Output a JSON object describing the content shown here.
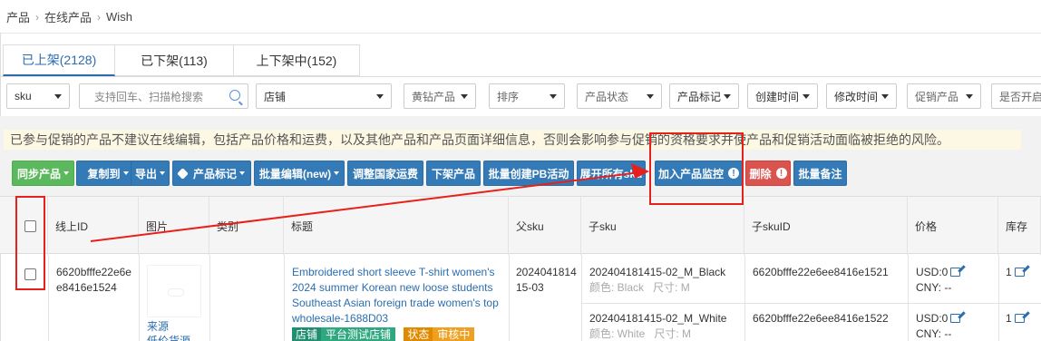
{
  "breadcrumb": [
    "产品",
    "在线产品",
    "Wish"
  ],
  "tabs": [
    {
      "label": "已上架(2128)",
      "active": true
    },
    {
      "label": "已下架(113)",
      "active": false
    },
    {
      "label": "上下架中(152)",
      "active": false
    }
  ],
  "filters": {
    "sku_select": "sku",
    "search_placeholder": "支持回车、扫描枪搜索",
    "shop_select": "店铺",
    "diamond_select": "黄钻产品",
    "sort_select": "排序",
    "status_select": "产品状态",
    "tag_select": "产品标记",
    "created_select": "创建时间",
    "modified_select": "修改时间",
    "promo_select": "促销产品",
    "enabled_select": "是否开启"
  },
  "warning": "已参与促销的产品不建议在线编辑，包括产品价格和运费，以及其他产品和产品页面详细信息，否则会影响参与促销的资格要求并使产品和促销活动面临被拒绝的风险。",
  "actions": {
    "sync": "同步产品",
    "copy": "复制到",
    "export": "导出",
    "tag": "产品标记",
    "batch_edit": "批量编辑(new)",
    "country_shipping": "调整国家运费",
    "delist": "下架产品",
    "create_pb": "批量创建PB活动",
    "expand_sku": "展开所有sku",
    "monitor": "加入产品监控",
    "delete": "删除",
    "batch_note": "批量备注"
  },
  "table": {
    "headers": [
      "线上ID",
      "图片",
      "类别",
      "标题",
      "父sku",
      "子sku",
      "子skuID",
      "价格",
      "库存"
    ],
    "row": {
      "online_id": "6620bfffe22e6ee8416e1524",
      "image_source_label": "来源",
      "image_low_price_label": "低价货源",
      "title": "Embroidered short sleeve T-shirt women's 2024 summer Korean new loose students Southeast Asian foreign trade women's top wholesale-1688D03",
      "parent_sku": "202404181415-03",
      "badge_shop_key": "店铺",
      "badge_shop_val": "平台测试店铺",
      "badge_status_key": "状态",
      "badge_status_val": "审核中",
      "variants": [
        {
          "sku": "202404181415-02_M_Black",
          "color": "颜色: Black",
          "size": "尺寸: M",
          "sku_id": "6620bfffe22e6ee8416e1521",
          "price_usd": "USD:0",
          "price_cny": "CNY: --",
          "stock": "1"
        },
        {
          "sku": "202404181415-02_M_White",
          "color": "颜色: White",
          "size": "尺寸: M",
          "sku_id": "6620bfffe22e6ee8416e1522",
          "price_usd": "USD:0",
          "price_cny": "CNY: --",
          "stock": "1"
        }
      ]
    }
  },
  "colors": {
    "primary": "#337ab7",
    "success": "#5cb85c",
    "danger": "#d9534f",
    "annotation": "#e8201b",
    "warning_bg": "#fcf8e3"
  }
}
